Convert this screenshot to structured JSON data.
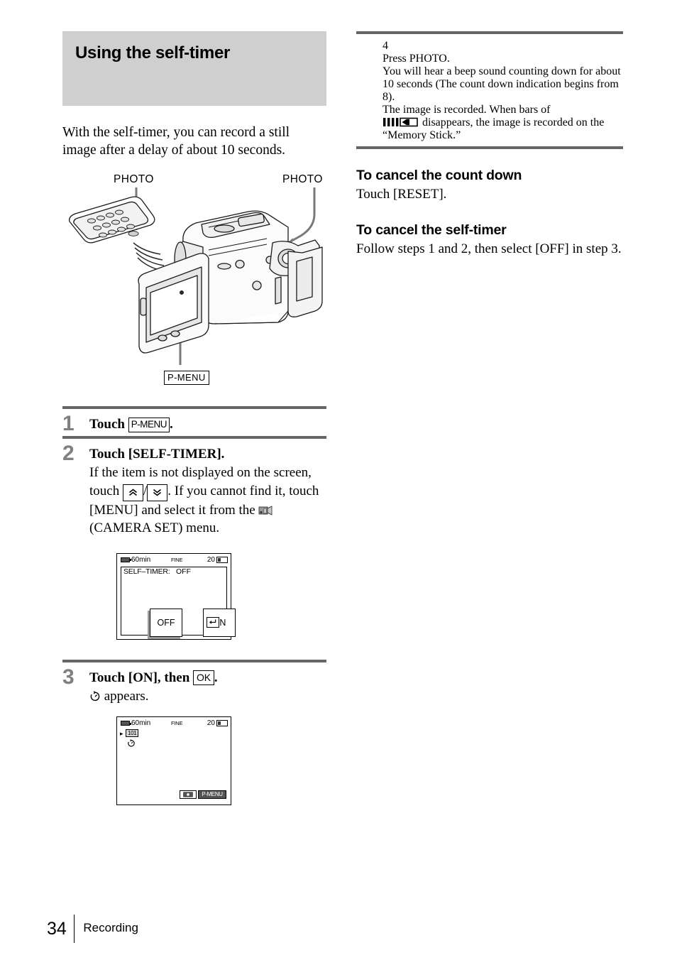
{
  "document": {
    "page_number": "34",
    "section": "Recording"
  },
  "left": {
    "banner_title": "Using the self-timer",
    "intro": "With the self-timer, you can record a still image after a delay of about 10 seconds.",
    "figure": {
      "label_photo_left": "PHOTO",
      "label_photo_right": "PHOTO",
      "label_pmenu": "P-MENU",
      "remote_icon": "remote-commander-illustration",
      "camcorder_icon": "camcorder-illustration"
    },
    "steps": [
      {
        "num": "1",
        "head_before": "Touch",
        "key": "P-MENU",
        "head_after": "."
      },
      {
        "num": "2",
        "head": "Touch [SELF-TIMER].",
        "body_1": "If the item is not displayed on the screen, touch",
        "body_2": "/",
        "body_3": ". If you cannot find it, touch [MENU] and select it from the",
        "body_4": "(CAMERA SET) menu."
      },
      {
        "num": "3",
        "head_before": "Touch [ON], then",
        "key": "OK",
        "head_after": ".",
        "body": "appears."
      }
    ],
    "lcd_a": {
      "battery_time": "60min",
      "quality": "FINE",
      "remaining": "20",
      "menu_label": "SELF–TIMER:",
      "menu_value": "OFF",
      "button_off": "OFF",
      "button_on": "ON",
      "return_icon": "return-arrow-icon"
    },
    "lcd_b": {
      "battery_time": "60min",
      "quality": "FINE",
      "remaining": "20",
      "chip_label": "101",
      "timer_icon": "self-timer-icon",
      "camera_button_icon": "camera-icon",
      "pmenu_button": "P-MENU"
    }
  },
  "right": {
    "step4": {
      "num": "4",
      "head": "Press PHOTO.",
      "body_1": "You will hear a beep sound counting down for about 10 seconds (The count down indication begins from 8).",
      "body_2": "The image is recorded. When bars of",
      "body_3": "disappears, the image is recorded on the “Memory Stick.”",
      "bars_icon": "recording-bars-icon"
    },
    "sections": [
      {
        "heading": "To cancel the count down",
        "text": "Touch [RESET]."
      },
      {
        "heading": "To cancel the self-timer",
        "text": "Follow steps 1 and 2, then select [OFF] in step 3."
      }
    ]
  },
  "colors": {
    "banner_bg": "#cfcfcf",
    "rule": "#666666",
    "step_number": "#808080"
  }
}
